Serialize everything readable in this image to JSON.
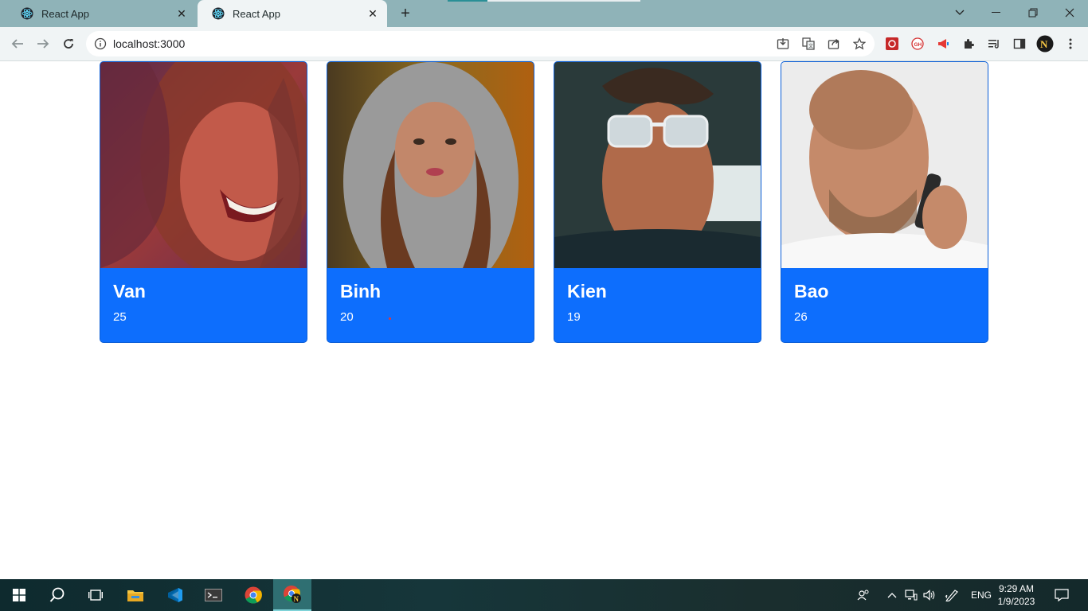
{
  "browser": {
    "tabs": [
      {
        "title": "React App",
        "active": false
      },
      {
        "title": "React App",
        "active": true
      }
    ],
    "url": "localhost:3000"
  },
  "cards": [
    {
      "name": "Van",
      "age": "25"
    },
    {
      "name": "Binh",
      "age": "20"
    },
    {
      "name": "Kien",
      "age": "19"
    },
    {
      "name": "Bao",
      "age": "26"
    }
  ],
  "taskbar": {
    "language": "ENG",
    "time": "9:29 AM",
    "date": "1/9/2023"
  },
  "colors": {
    "card_bg": "#0d6efd",
    "titlebar": "#8fb3b8",
    "toolbar": "#f0f4f5"
  }
}
